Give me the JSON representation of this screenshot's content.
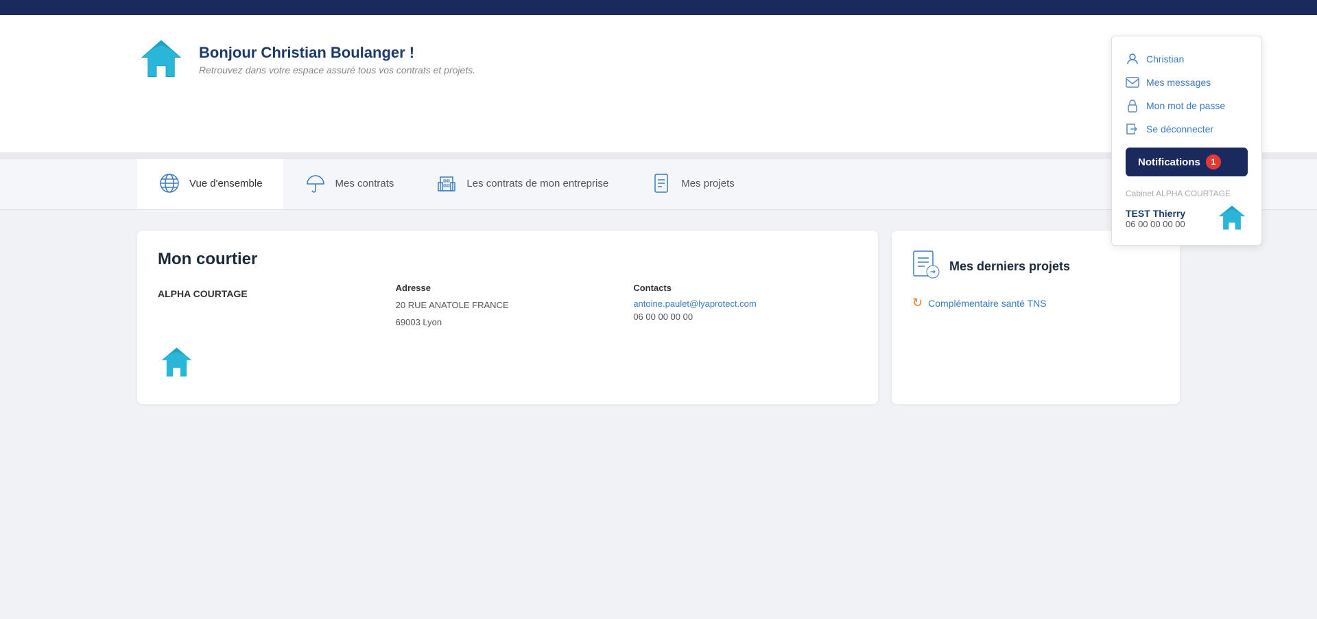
{
  "topbar": {},
  "header": {
    "greeting": "Bonjour Christian Boulanger !",
    "subtitle": "Retrouvez dans votre espace assuré tous vos contrats et projets."
  },
  "userPanel": {
    "username": "Christian",
    "menuItems": [
      {
        "id": "messages",
        "label": "Mes messages",
        "icon": "envelope"
      },
      {
        "id": "password",
        "label": "Mon mot de passe",
        "icon": "lock"
      },
      {
        "id": "logout",
        "label": "Se déconnecter",
        "icon": "logout"
      }
    ],
    "notificationsLabel": "Notifications",
    "notificationsCount": "1",
    "cabinetLabel": "Cabinet ALPHA COURTAGE",
    "agentName": "TEST Thierry",
    "agentPhone": "06 00 00 00 00"
  },
  "tabs": [
    {
      "id": "vue-ensemble",
      "label": "Vue d'ensemble",
      "icon": "globe",
      "active": true
    },
    {
      "id": "mes-contrats",
      "label": "Mes contrats",
      "icon": "umbrella",
      "active": false
    },
    {
      "id": "contrats-entreprise",
      "label": "Les contrats de mon entreprise",
      "icon": "building",
      "active": false
    },
    {
      "id": "mes-projets",
      "label": "Mes projets",
      "icon": "document",
      "active": false
    }
  ],
  "courtier": {
    "title": "Mon courtier",
    "companyName": "ALPHA COURTAGE",
    "addressLabel": "Adresse",
    "addressLine1": "20 RUE ANATOLE FRANCE",
    "addressLine2": "69003 Lyon",
    "contactsLabel": "Contacts",
    "email": "antoine.paulet@lyaprotect.com",
    "phone": "06 00 00 00 00"
  },
  "projets": {
    "title": "Mes derniers projets",
    "items": [
      {
        "label": "Complémentaire santé TNS"
      }
    ]
  }
}
